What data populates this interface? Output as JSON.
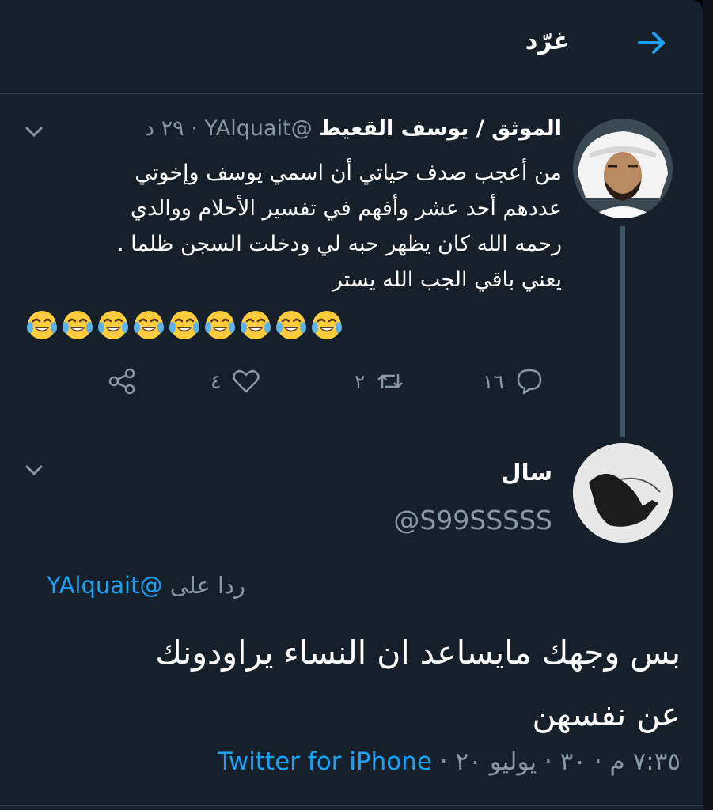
{
  "header": {
    "title": "غرّد",
    "back_icon": "arrow-right-icon"
  },
  "tweet": {
    "author_name": "الموثق / يوسف القعيط",
    "meta": "@YAlquait · ٢٩ د",
    "lines": [
      "من أعجب صدف حياتي أن اسمي يوسف وإخوتي",
      "عددهم أحد عشر وأفهم في تفسير الأحلام ووالدي",
      "رحمه الله كان يظهر حبه لي ودخلت السجن ظلما .",
      "يعني باقي الجب الله يستر"
    ],
    "emoji_count": 9,
    "actions": {
      "replies": "١٦",
      "retweets": "٢",
      "likes": "٤"
    }
  },
  "reply": {
    "author_name": "سال",
    "handle": "@S99SSSSS",
    "reply_prefix": "ردا على",
    "reply_to_handle": "@YAlquait",
    "lines": [
      "بس وجهك مايساعد ان النساء يراودونك",
      "عن نفسهن"
    ],
    "timestamp": "٧:٣٥ م · ٣٠ · يوليو ٢٠ ·",
    "source": "Twitter for iPhone"
  },
  "colors": {
    "background": "#15202b",
    "accent": "#1da1f2",
    "secondary_text": "#8899a6",
    "border": "#38444d"
  }
}
